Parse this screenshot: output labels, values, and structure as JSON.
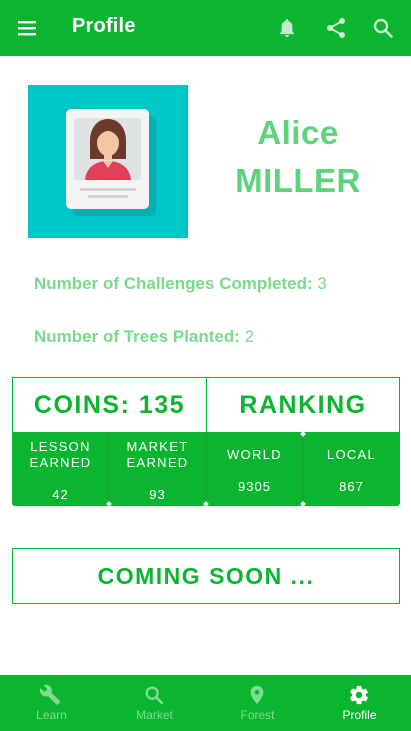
{
  "appbar": {
    "title": "Profile",
    "icons": [
      "menu-icon",
      "bell-icon",
      "share-icon",
      "search-icon"
    ]
  },
  "profile": {
    "first_name": "Alice",
    "last_name": "MILLER",
    "challenges_label": "Number of Challenges Completed:",
    "challenges_value": "3",
    "trees_label": "Number of Trees Planted:",
    "trees_value": "2"
  },
  "coins": {
    "label": "COINS: 135"
  },
  "ranking": {
    "label": "RANKING"
  },
  "stats": [
    {
      "label_line1": "LESSON",
      "label_line2": "EARNED",
      "value": "42"
    },
    {
      "label_line1": "MARKET",
      "label_line2": "EARNED",
      "value": "93"
    },
    {
      "label_line1": "WORLD",
      "label_line2": "",
      "value": "9305"
    },
    {
      "label_line1": "LOCAL",
      "label_line2": "",
      "value": "867"
    }
  ],
  "coming_soon": {
    "label": "COMING SOON ..."
  },
  "nav": [
    {
      "label": "Learn",
      "icon": "wrench-icon",
      "active": false
    },
    {
      "label": "Market",
      "icon": "search-icon",
      "active": false
    },
    {
      "label": "Forest",
      "icon": "location-pin-icon",
      "active": false
    },
    {
      "label": "Profile",
      "icon": "gear-icon",
      "active": true
    }
  ],
  "colors": {
    "primary": "#0cb52f",
    "name_text": "#5dd37b",
    "stat_text": "#7ad98c",
    "avatar_bg": "#00c6c8",
    "nav_inactive": "#7fdc91"
  }
}
